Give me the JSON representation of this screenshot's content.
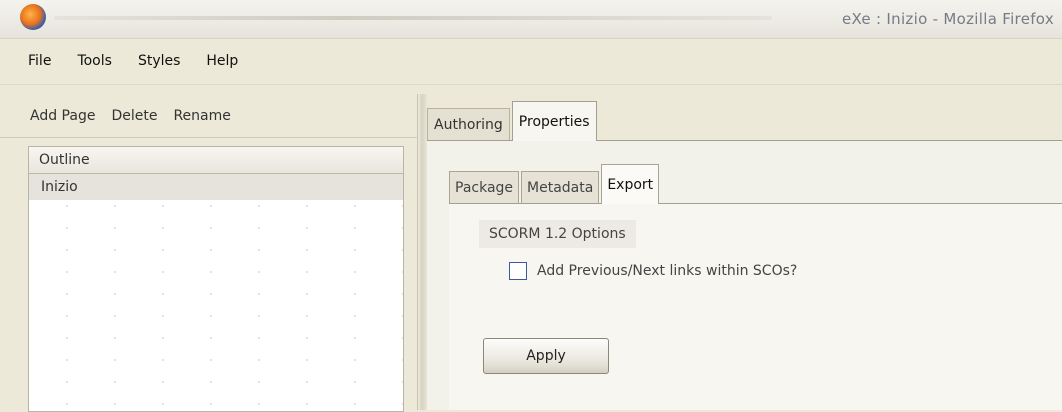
{
  "window": {
    "title": "eXe : Inizio - Mozilla Firefox",
    "app_icon": "firefox-icon"
  },
  "menu": {
    "items": [
      "File",
      "Tools",
      "Styles",
      "Help"
    ]
  },
  "outline_toolbar": {
    "add_page": "Add Page",
    "delete": "Delete",
    "rename": "Rename"
  },
  "outline": {
    "header": "Outline",
    "nodes": [
      "Inizio"
    ]
  },
  "main_tabs": {
    "items": [
      "Authoring",
      "Properties"
    ],
    "active": "Properties"
  },
  "properties_tabs": {
    "items": [
      "Package",
      "Metadata",
      "Export"
    ],
    "active": "Export"
  },
  "export": {
    "section_label": "SCORM 1.2 Options",
    "checkbox_label": "Add Previous/Next links within SCOs?",
    "checkbox_checked": false,
    "apply_label": "Apply"
  }
}
